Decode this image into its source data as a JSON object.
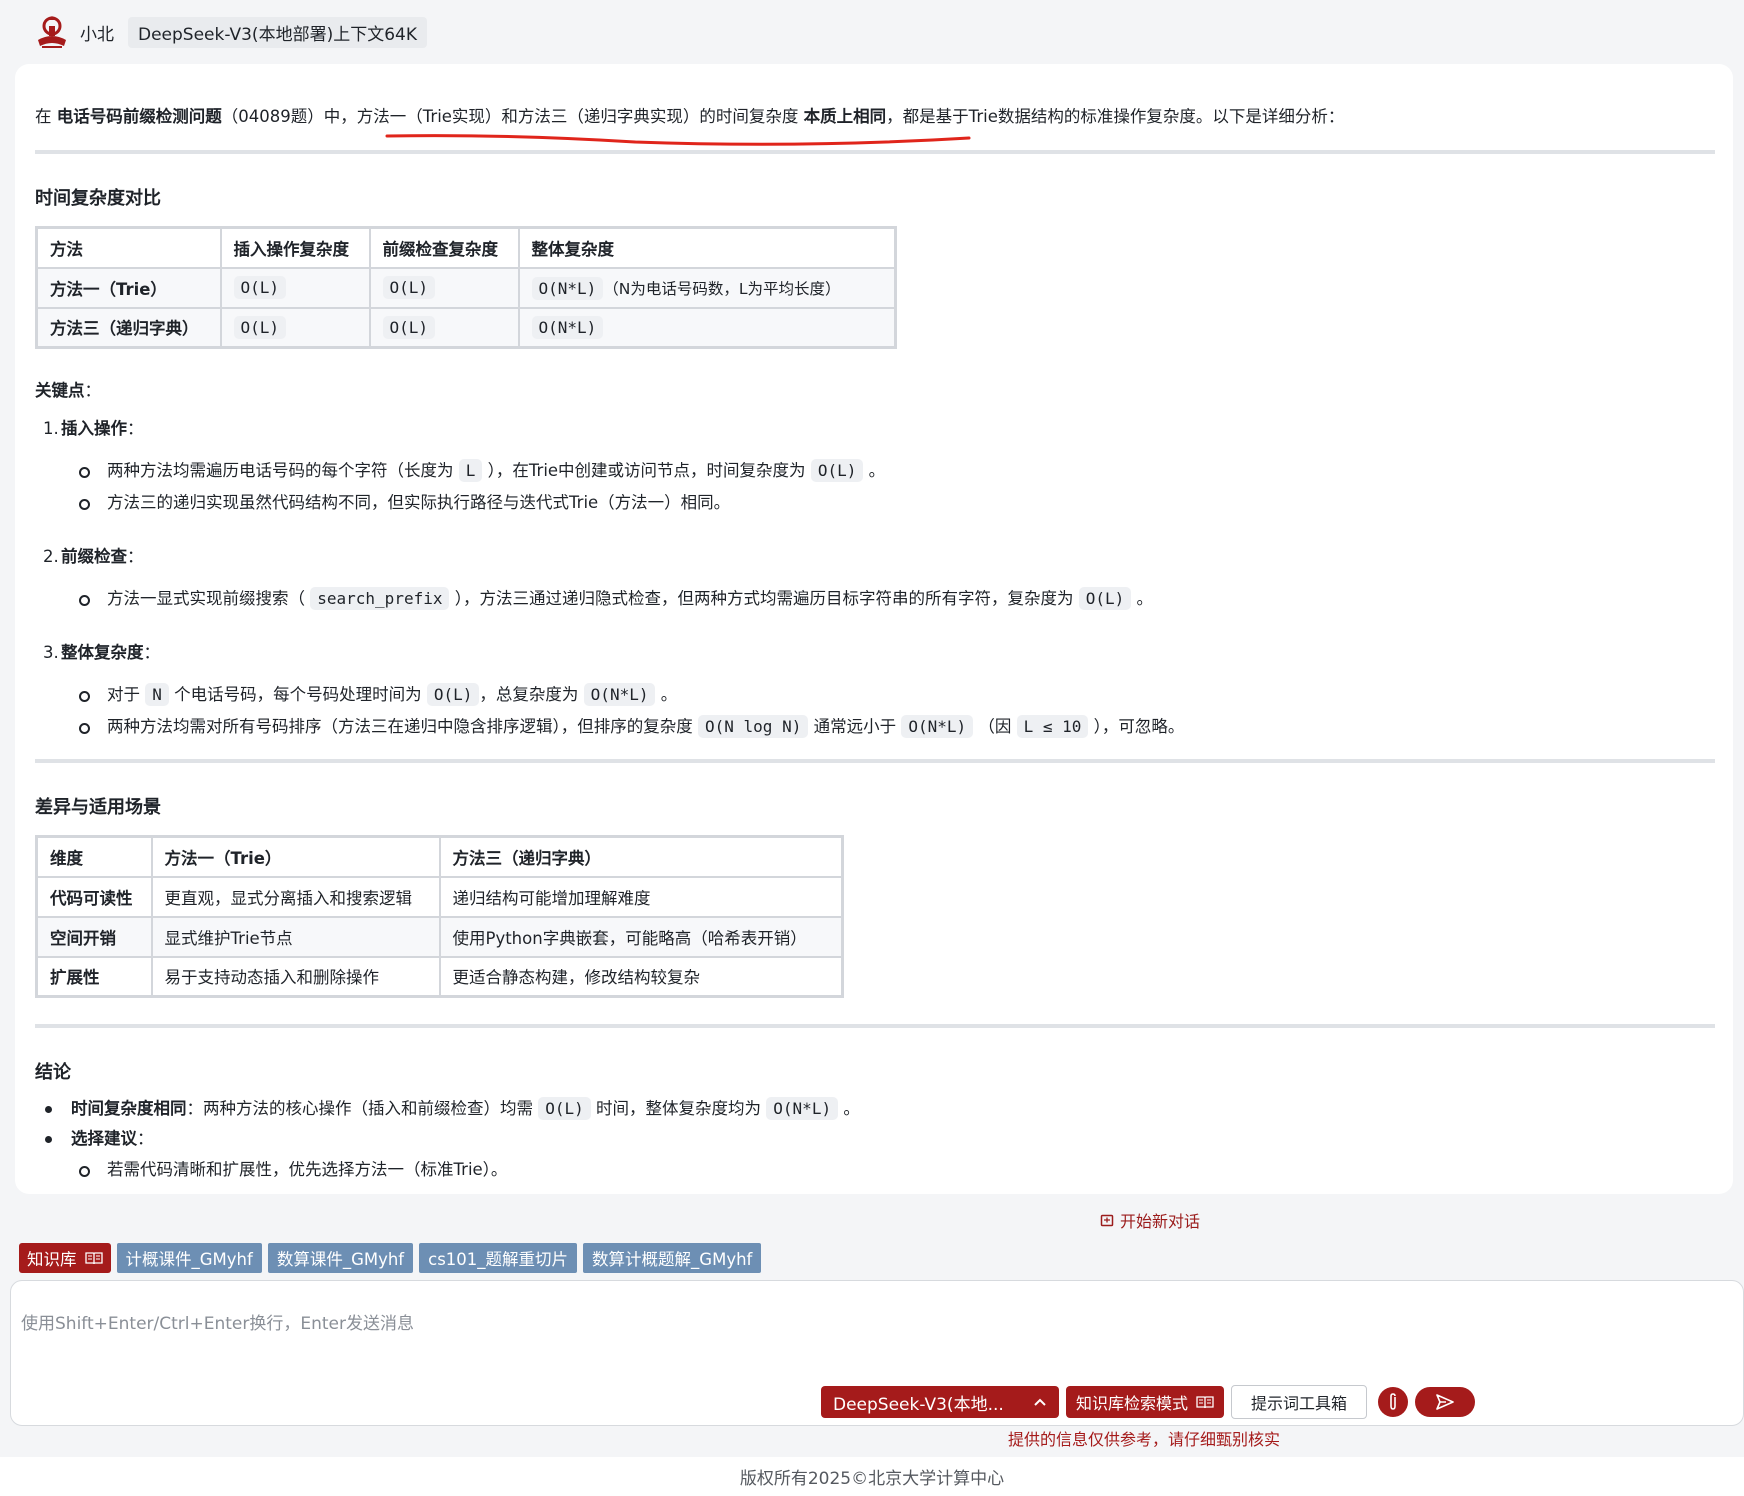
{
  "header": {
    "bot_name": "小北",
    "model_badge": "DeepSeek-V3(本地部署)上下文64K"
  },
  "message": {
    "intro": {
      "p1": "在 ",
      "b1": "电话号码前缀检测问题",
      "p2": "（04089题）中，",
      "u1": "方法一（Trie实现）和方法三（递归字典实现）的时间复杂度 ",
      "b2": "本质上相同",
      "p3": "，都是基于Trie数据结构的标准操作复杂度。以下是详细分析："
    },
    "section1_title": "时间复杂度对比",
    "table1": {
      "headers": [
        "方法",
        "插入操作复杂度",
        "前缀检查复杂度",
        "整体复杂度"
      ],
      "rows": [
        {
          "method": "方法一（Trie）",
          "insert": "O(L)",
          "check": "O(L)",
          "overall": "O(N*L)",
          "note": "（N为电话号码数，L为平均长度）"
        },
        {
          "method": "方法三（递归字典）",
          "insert": "O(L)",
          "check": "O(L)",
          "overall": "O(N*L)",
          "note": ""
        }
      ]
    },
    "key_points_label": "关键点",
    "key_points_colon": "：",
    "points": [
      {
        "num": "1.",
        "title": "插入操作",
        "items": [
          {
            "t1": "两种方法均需遍历电话号码的每个字符（长度为 ",
            "c1": "L",
            "t2": " ），在Trie中创建或访问节点，时间复杂度为 ",
            "c2": "O(L)",
            "t3": " 。"
          },
          {
            "t1": "方法三的递归实现虽然代码结构不同，但实际执行路径与迭代式Trie（方法一）相同。"
          }
        ]
      },
      {
        "num": "2.",
        "title": "前缀检查",
        "items": [
          {
            "t1": "方法一显式实现前缀搜索（ ",
            "c1": "search_prefix",
            "t2": " ），方法三通过递归隐式检查，但两种方式均需遍历目标字符串的所有字符，复杂度为 ",
            "c2": "O(L)",
            "t3": " 。"
          }
        ]
      },
      {
        "num": "3.",
        "title": "整体复杂度",
        "items": [
          {
            "t1": "对于 ",
            "c1": "N",
            "t2": " 个电话号码，每个号码处理时间为 ",
            "c2": "O(L)",
            "t3": "，总复杂度为 ",
            "c3": "O(N*L)",
            "t4": " 。"
          },
          {
            "t1": "两种方法均需对所有号码排序（方法三在递归中隐含排序逻辑），但排序的复杂度 ",
            "c1": "O(N log N)",
            "t2": " 通常远小于 ",
            "c2": "O(N*L)",
            "t3": " （因 ",
            "c3": "L ≤ 10",
            "t4": " ），可忽略。"
          }
        ]
      }
    ],
    "section2_title": "差异与适用场景",
    "table2": {
      "headers": [
        "维度",
        "方法一（Trie）",
        "方法三（递归字典）"
      ],
      "rows": [
        [
          "代码可读性",
          "更直观，显式分离插入和搜索逻辑",
          "递归结构可能增加理解难度"
        ],
        [
          "空间开销",
          "显式维护Trie节点",
          "使用Python字典嵌套，可能略高（哈希表开销）"
        ],
        [
          "扩展性",
          "易于支持动态插入和删除操作",
          "更适合静态构建，修改结构较复杂"
        ]
      ]
    },
    "section3_title": "结论",
    "conclusion": {
      "c1_label": "时间复杂度相同",
      "c1_t1": "：两种方法的核心操作（插入和前缀检查）均需 ",
      "c1_code1": "O(L)",
      "c1_t2": " 时间，整体复杂度均为 ",
      "c1_code2": "O(N*L)",
      "c1_t3": " 。",
      "c2_label": "选择建议",
      "c2_colon": "：",
      "c2_item1": "若需代码清晰和扩展性，优先选择方法一（标准Trie）。"
    }
  },
  "new_chat_label": "开始新对话",
  "knowledge": {
    "main_label": "知识库",
    "tags": [
      "计概课件_GMyhf",
      "数算课件_GMyhf",
      "cs101_题解重切片",
      "数算计概题解_GMyhf"
    ]
  },
  "input": {
    "placeholder": "使用Shift+Enter/Ctrl+Enter换行，Enter发送消息",
    "model_button": "DeepSeek-V3(本地...",
    "mode_button": "知识库检索模式",
    "prompt_button": "提示词工具箱"
  },
  "disclaimer": "提供的信息仅供参考，请仔细甄别核实",
  "footer": "版权所有2025©北京大学计算中心",
  "colors": {
    "brand_red": "#a51b1b",
    "tag_blue": "#6d8fb4",
    "annotation_red": "#e0251b"
  }
}
